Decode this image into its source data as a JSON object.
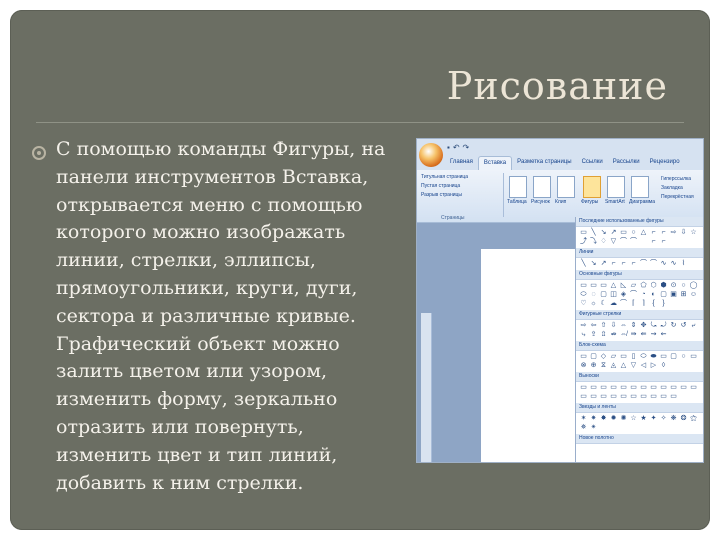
{
  "slide": {
    "title": "Рисование",
    "body_lines": [
      "С помощью команды Фигуры, на",
      "панели инструментов Вставка,",
      "открывается меню с помощью",
      "которого можно изображать",
      "линии, стрелки, эллипсы,",
      "прямоугольники, круги, дуги,",
      "сектора и различные кривые.",
      "Графический объект можно",
      "залить цветом или узором,",
      "изменить форму, зеркально",
      "отразить или повернуть,",
      "изменить цвет и тип линий,",
      "добавить к ним стрелки."
    ]
  },
  "screenshot": {
    "tabs": [
      "Главная",
      "Вставка",
      "Разметка страницы",
      "Ссылки",
      "Рассылки",
      "Рецензиро"
    ],
    "active_tab": 1,
    "pages_group": {
      "items": [
        "Титульная страница",
        "Пустая страница",
        "Разрыв страницы"
      ],
      "label": "Страницы"
    },
    "ribbon_buttons": [
      "Таблица",
      "Рисунок",
      "Клип",
      "Фигуры",
      "SmartArt",
      "Диаграмма"
    ],
    "right_items": [
      "Гиперссылка",
      "Закладка",
      "Перекрёстная"
    ],
    "gallery": {
      "sections": [
        {
          "title": "Последние использованные фигуры",
          "glyphs": "▭╲↘↗▭○△⌐⌐⇨⇩☆⤴⤵♢▽⌒⌒ ⌐⌐"
        },
        {
          "title": "Линии",
          "glyphs": "╲↘↗⌐⌐⌐⌒⌒∿∿⌇"
        },
        {
          "title": "Основные фигуры",
          "glyphs": "▭▭▭△◺▱⬠⬡⬢⊙○◯⬭◌▢◫◈⌒◔◐▢▣⊞☺♡☼☾☁⌒⌈⌉{}"
        },
        {
          "title": "Фигурные стрелки",
          "glyphs": "⇨⇦⇧⇩⇔⇕✥⤿⤾↻↺⤶⤷⇪⇫⇏⇎⇛⇚⇝⇜"
        },
        {
          "title": "Блок-схема",
          "glyphs": "▭▢◇▱▭▯⬭⬬▭▢○▭⊗⊕⧖◬△▽◁▷◊"
        },
        {
          "title": "Выноски",
          "glyphs": "▭▭▭▭▭▭▭▭▭▭▭▭▭▭▭▭▭▭▭▭▭▭"
        },
        {
          "title": "Звезды и ленты",
          "glyphs": "✶✷✸✹✺☆★✦✧❋❂⚝✵✴"
        },
        {
          "title": "Новое полотно",
          "glyphs": ""
        }
      ]
    }
  }
}
